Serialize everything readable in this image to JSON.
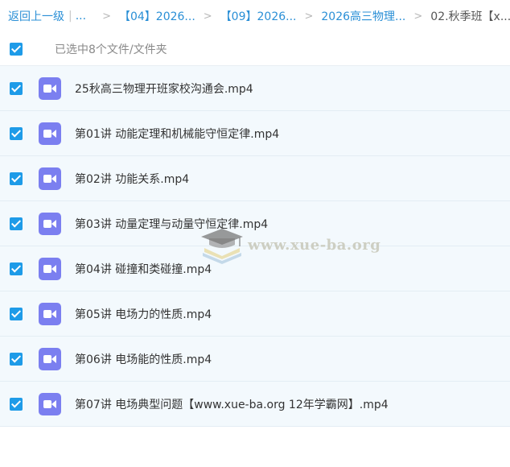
{
  "breadcrumb": {
    "back_label": "返回上一级",
    "pipe": "|",
    "ellipsis": "...",
    "separator": ">",
    "items": [
      "【04】2026...",
      "【09】2026...",
      "2026高三物理..."
    ],
    "current": "02.秋季班【x..."
  },
  "selection": {
    "summary": "已选中8个文件/文件夹",
    "all_checked": true
  },
  "files": [
    {
      "name": "25秋高三物理开班家校沟通会.mp4",
      "checked": true,
      "icon": "video-file-icon"
    },
    {
      "name": "第01讲 动能定理和机械能守恒定律.mp4",
      "checked": true,
      "icon": "video-file-icon"
    },
    {
      "name": "第02讲 功能关系.mp4",
      "checked": true,
      "icon": "video-file-icon"
    },
    {
      "name": "第03讲 动量定理与动量守恒定律.mp4",
      "checked": true,
      "icon": "video-file-icon"
    },
    {
      "name": "第04讲 碰撞和类碰撞.mp4",
      "checked": true,
      "icon": "video-file-icon"
    },
    {
      "name": "第05讲 电场力的性质.mp4",
      "checked": true,
      "icon": "video-file-icon"
    },
    {
      "name": "第06讲 电场能的性质.mp4",
      "checked": true,
      "icon": "video-file-icon"
    },
    {
      "name": "第07讲 电场典型问题【www.xue-ba.org 12年学霸网】.mp4",
      "checked": true,
      "icon": "video-file-icon"
    }
  ],
  "watermark": {
    "text": "www.xue-ba.org"
  },
  "colors": {
    "accent": "#2a8fd6",
    "checkbox": "#1e9be8",
    "video_icon": "#7b7ff0",
    "row_background": "#f3f9fd"
  }
}
